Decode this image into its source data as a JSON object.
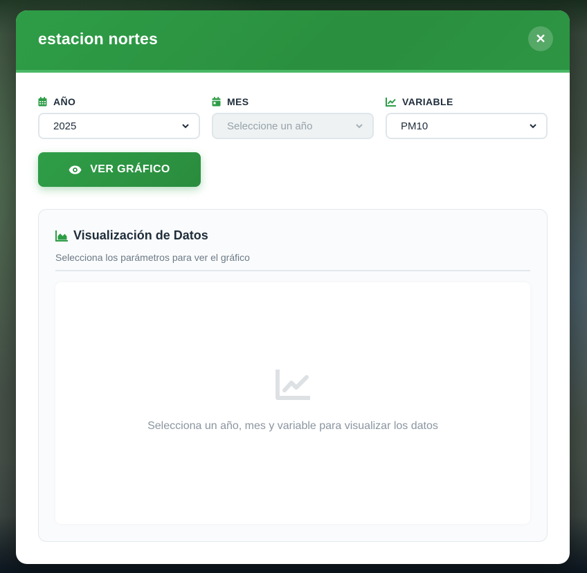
{
  "modal": {
    "title": "estacion nortes",
    "close_glyph": "✕"
  },
  "filters": {
    "year": {
      "label": "AÑO",
      "value": "2025",
      "icon": "calendar-icon"
    },
    "month": {
      "label": "MES",
      "value": "Seleccione un año",
      "icon": "calendar-day-icon",
      "disabled": true
    },
    "variable": {
      "label": "VARIABLE",
      "value": "PM10",
      "icon": "chart-line-icon"
    }
  },
  "actions": {
    "view_chart_label": "VER GRÁFICO"
  },
  "panel": {
    "title": "Visualización de Datos",
    "subtitle": "Selecciona los parámetros para ver el gráfico",
    "empty_message": "Selecciona un año, mes y variable para visualizar los datos"
  },
  "colors": {
    "primary": "#2e9d47",
    "accent_border": "#4ab866",
    "text": "#1f2d3a",
    "muted": "#8a95a0"
  }
}
